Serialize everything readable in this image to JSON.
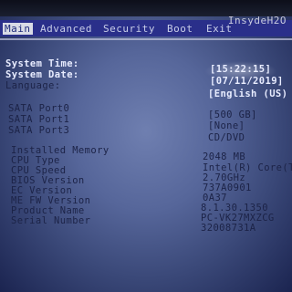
{
  "brand": "InsydeH2O",
  "menu": [
    "Main",
    "Advanced",
    "Security",
    "Boot",
    "Exit"
  ],
  "system": {
    "time_label": "System Time:",
    "time_value": "[15:22:15]",
    "date_label": "System Date:",
    "date_value": "[07/11/2019]",
    "language_label": "Language:",
    "language_value": "[English (US)"
  },
  "ports": [
    {
      "label": "SATA Port0",
      "value": "[500 GB]"
    },
    {
      "label": "SATA Port1",
      "value": "[None]"
    },
    {
      "label": "SATA Port3",
      "value": "CD/DVD"
    }
  ],
  "info": [
    {
      "label": "Installed Memory",
      "value": "2048 MB"
    },
    {
      "label": "CPU Type",
      "value": "Intel(R) Core(T"
    },
    {
      "label": "CPU Speed",
      "value": "2.70GHz"
    },
    {
      "label": "BIOS Version",
      "value": "737A0901"
    },
    {
      "label": "EC Version",
      "value": "0A37"
    },
    {
      "label": "ME FW Version",
      "value": "8.1.30.1350"
    },
    {
      "label": "Product Name",
      "value": "PC-VK27MXZCG"
    },
    {
      "label": "Serial Number",
      "value": "32008731A"
    }
  ]
}
